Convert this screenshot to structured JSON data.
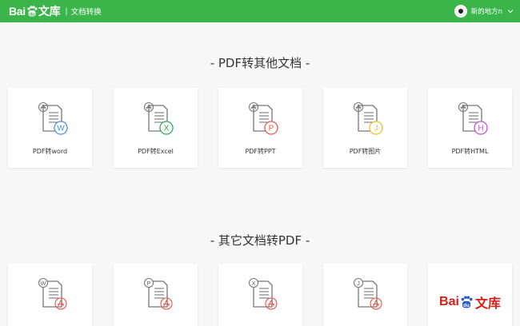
{
  "header": {
    "logo_left": "Bai",
    "logo_right": "文库",
    "paw_inner": "du",
    "separator": "|",
    "subtitle": "文档转换",
    "username": "新的地方n"
  },
  "sections": [
    {
      "title": "- PDF转其他文档 -",
      "cards": [
        {
          "label": "PDF转word",
          "badge": "W",
          "color": "#4a90e2"
        },
        {
          "label": "PDF转Excel",
          "badge": "X",
          "color": "#2eaa5c"
        },
        {
          "label": "PDF转PPT",
          "badge": "P",
          "color": "#e85b4a"
        },
        {
          "label": "PDF转图片",
          "badge": "J",
          "color": "#f0c030"
        },
        {
          "label": "PDF转HTML",
          "badge": "H",
          "color": "#c84fd8"
        }
      ]
    },
    {
      "title": "- 其它文档转PDF -",
      "cards": [
        {
          "badge": "W"
        },
        {
          "badge": "P"
        },
        {
          "badge": "X"
        },
        {
          "badge": "J"
        },
        {
          "logo_left": "Bai",
          "logo_inner": "du",
          "logo_right": "文库"
        }
      ]
    }
  ],
  "colors": {
    "header_bg": "#3ab54a",
    "pdf_red": "#e8564a",
    "baidu_red": "#d91e18"
  }
}
